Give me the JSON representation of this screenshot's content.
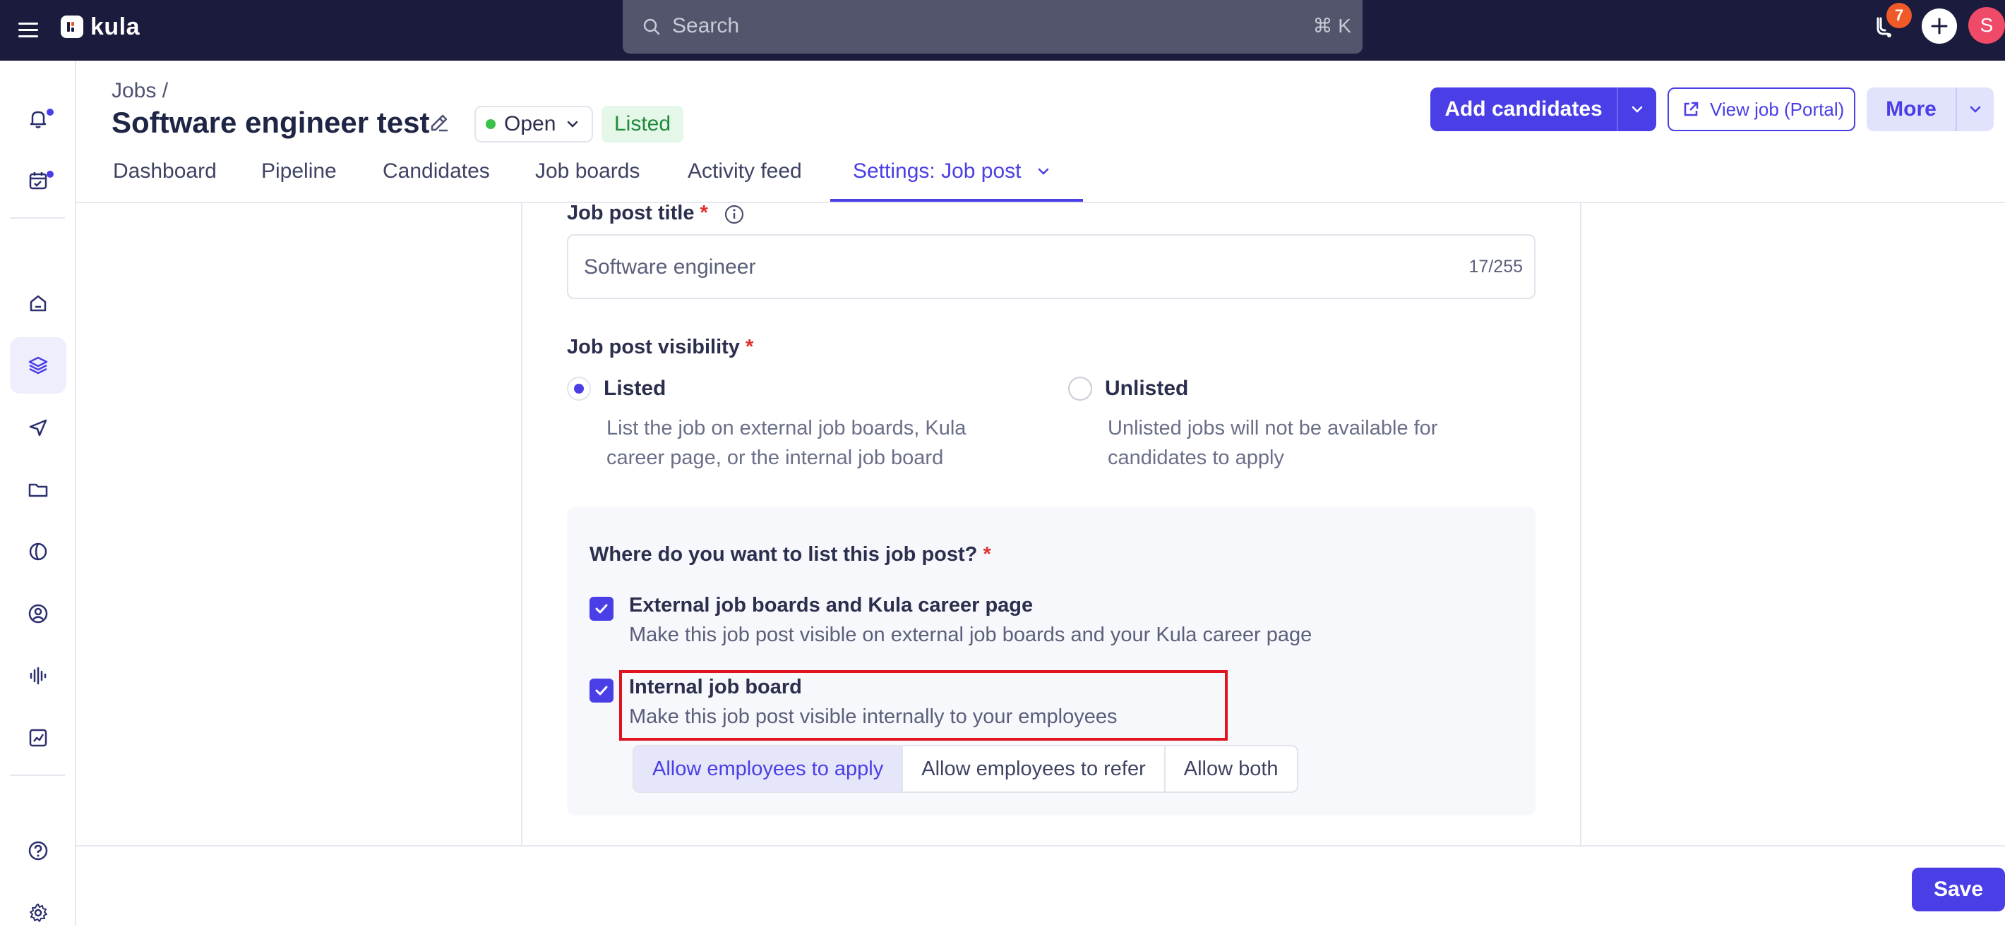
{
  "topbar": {
    "brand": "kula",
    "search_placeholder": "Search",
    "search_shortcut": "⌘ K",
    "notification_count": "7",
    "avatar_initial": "S"
  },
  "header": {
    "breadcrumb": "Jobs /",
    "title": "Software engineer test",
    "status": "Open",
    "listed_badge": "Listed",
    "add_candidates": "Add candidates",
    "view_job": "View job (Portal)",
    "more": "More"
  },
  "tabs": [
    "Dashboard",
    "Pipeline",
    "Candidates",
    "Job boards",
    "Activity feed",
    "Settings: Job post"
  ],
  "active_tab": "Settings: Job post",
  "form": {
    "title_label": "Job post title",
    "title_value": "Software engineer",
    "title_counter": "17/255",
    "visibility_label": "Job post visibility",
    "visibility_options": [
      {
        "label": "Listed",
        "desc_line1": "List the job on external job boards, Kula",
        "desc_line2": "career page, or the internal job board",
        "selected": true
      },
      {
        "label": "Unlisted",
        "desc_line1": "Unlisted jobs will not be available for",
        "desc_line2": "candidates to apply",
        "selected": false
      }
    ],
    "list_where_label": "Where do you want to list this job post?",
    "list_options": [
      {
        "title": "External job boards and Kula career page",
        "desc": "Make this job post visible on external job boards and your Kula career page",
        "checked": true
      },
      {
        "title": "Internal job board",
        "desc": "Make this job post visible internally to your employees",
        "checked": true
      }
    ],
    "internal_modes": [
      "Allow employees to apply",
      "Allow employees to refer",
      "Allow both"
    ],
    "internal_mode_selected": "Allow employees to apply",
    "required_mark": "*"
  },
  "footer": {
    "save": "Save"
  },
  "colors": {
    "accent": "#4a3ee6",
    "topbar": "#1a1b3d",
    "highlight": "#e0141e"
  }
}
